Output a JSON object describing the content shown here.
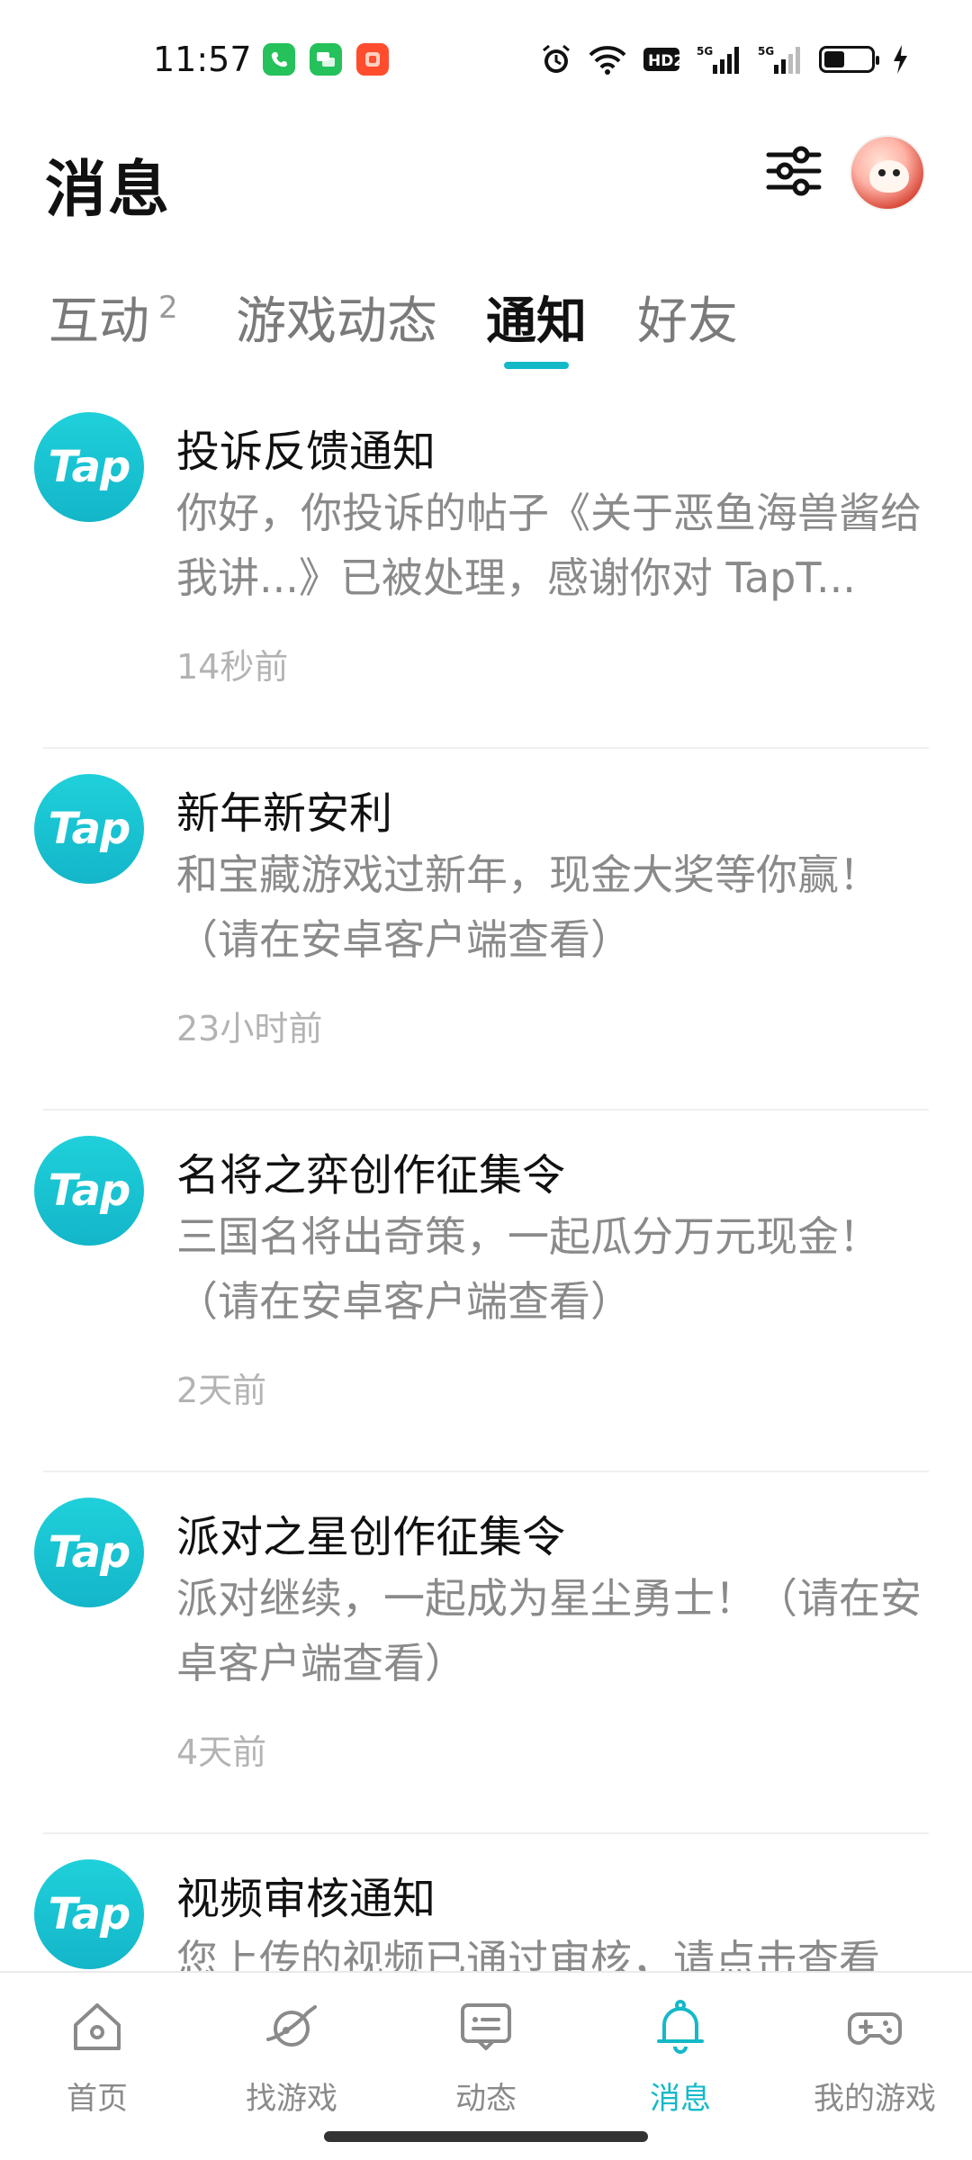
{
  "status_bar": {
    "time": "11:57",
    "network_labels": [
      "5G",
      "5G"
    ],
    "hd_label": "HD2",
    "icons": [
      "phone-app-icon",
      "chat-app-icon",
      "taobao-app-icon",
      "alarm-icon",
      "wifi-icon",
      "hd-icon",
      "signal-5g-icon",
      "signal-5g-icon",
      "battery-icon",
      "charging-icon"
    ]
  },
  "header": {
    "title": "消息"
  },
  "tabs": [
    {
      "label": "互动",
      "badge": "2"
    },
    {
      "label": "游戏动态"
    },
    {
      "label": "通知",
      "active": true
    },
    {
      "label": "好友"
    }
  ],
  "logo_text": "Tap",
  "notifications": [
    {
      "title": "投诉反馈通知",
      "body": "你好，你投诉的帖子《关于恶鱼海兽酱给我讲...》已被处理，感谢你对 TapT...",
      "time": "14秒前"
    },
    {
      "title": "新年新安利",
      "body": "和宝藏游戏过新年，现金大奖等你赢！（请在安卓客户端查看）",
      "time": "23小时前"
    },
    {
      "title": "名将之弈创作征集令",
      "body": "三国名将出奇策，一起瓜分万元现金！（请在安卓客户端查看）",
      "time": "2天前"
    },
    {
      "title": "派对之星创作征集令",
      "body": "派对继续，一起成为星尘勇士！（请在安卓客户端查看）",
      "time": "4天前"
    },
    {
      "title": "视频审核通知",
      "body": "您上传的视频已通过审核，请点击查看",
      "time": ""
    }
  ],
  "bottom_nav": [
    {
      "label": "首页",
      "icon": "home-icon"
    },
    {
      "label": "找游戏",
      "icon": "planet-icon"
    },
    {
      "label": "动态",
      "icon": "feed-icon"
    },
    {
      "label": "消息",
      "icon": "bell-icon",
      "active": true
    },
    {
      "label": "我的游戏",
      "icon": "gamepad-icon"
    }
  ],
  "colors": {
    "accent": "#14b9c8",
    "text_primary": "#111111",
    "text_secondary": "#8a8a8a",
    "text_muted": "#b3b3b3"
  }
}
